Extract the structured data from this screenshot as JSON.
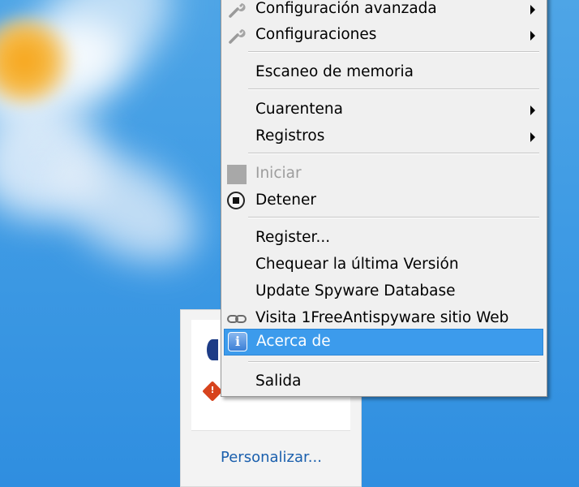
{
  "tray": {
    "customize_link": "Personalizar..."
  },
  "menu": {
    "items": [
      {
        "label": "Configuración avanzada",
        "icon": "wrench-icon",
        "submenu": true
      },
      {
        "label": "Configuraciones",
        "icon": "wrench-icon",
        "submenu": true
      },
      {
        "label": "Escaneo de memoria"
      },
      {
        "label": "Cuarentena",
        "submenu": true
      },
      {
        "label": "Registros",
        "submenu": true
      },
      {
        "label": "Iniciar",
        "icon": "gray-square-icon",
        "disabled": true
      },
      {
        "label": "Detener",
        "icon": "stop-icon"
      },
      {
        "label": "Register..."
      },
      {
        "label": "Chequear la última Versión"
      },
      {
        "label": "Update Spyware Database"
      },
      {
        "label": "Visita 1FreeAntispyware sitio Web",
        "icon": "link-chain-icon"
      },
      {
        "label": "Acerca de",
        "icon": "info-icon",
        "highlighted": true
      },
      {
        "label": "Salida"
      }
    ],
    "highlight_color": "#3c9bec"
  }
}
